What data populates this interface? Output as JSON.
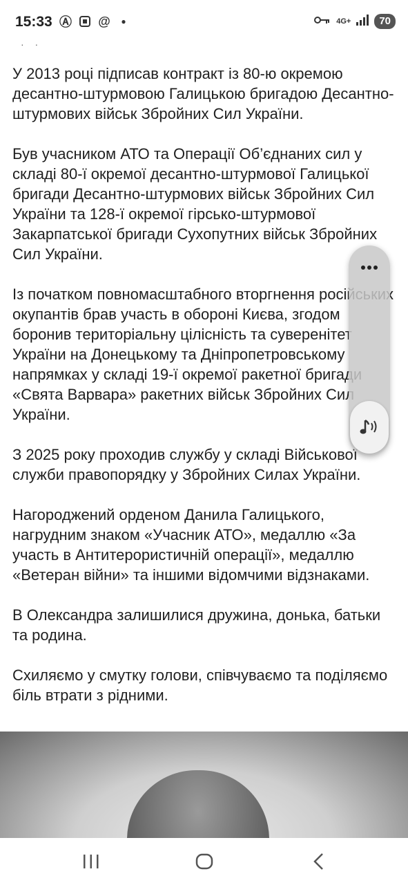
{
  "status_bar": {
    "time": "15:33",
    "network": "4G+",
    "battery": "70"
  },
  "article": {
    "paragraphs": [
      "У 2013 році підписав контракт із 80-ю окремою десантно-штурмовою Галицькою бригадою Десантно-штурмових військ Збройних Сил України.",
      "Був учасником АТО та Операції Об’єднаних сил у складі 80-ї окремої десантно-штурмової Галицької бригади Десантно-штурмових військ Збройних Сил України та 128-ї окремої гірсько-штурмової Закарпатської бригади Сухопутних військ Збройних Сил України.",
      "Із початком повномасштабного вторгнення російських окупантів брав участь в обороні Києва, згодом боронив територіальну цілісність та суверенітет України на Донецькому та Дніпропетровському напрямках у складі 19-ї окремої ракетної бригади «Свята Варвара» ракетних військ Збройних Сил України.",
      "З 2025 року проходив службу у складі Військової служби правопорядку у Збройних Силах України.",
      "Нагороджений орденом Данила Галицького, нагрудним знаком «Учасник АТО», медаллю «За участь в Антитерористичній операції», медаллю «Ветеран війни» та іншими відомчими відзнаками.",
      "В Олександра залишилися дружина, донька, батьки та родина.",
      "Схиляємо у смутку голови, співчуваємо та поділяємо біль втрати з рідними."
    ]
  },
  "floating_panel": {
    "more_icon": "more-horizontal-icon",
    "audio_icon": "music-note-sound-icon"
  },
  "nav_bar": {
    "recents_icon": "recents-icon",
    "home_icon": "home-icon",
    "back_icon": "back-icon"
  }
}
